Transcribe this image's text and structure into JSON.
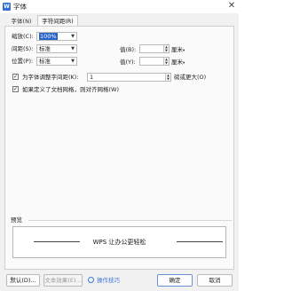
{
  "window": {
    "title": "字体",
    "app_icon_letter": "W",
    "close_glyph": "✕"
  },
  "tabs": [
    {
      "label": "字体(N)",
      "active": false
    },
    {
      "label": "字符间距(R)",
      "active": true
    }
  ],
  "fields": {
    "scale": {
      "label": "缩放(C):",
      "value": "100%"
    },
    "spacing": {
      "label": "间距(S):",
      "value": "标准",
      "value_label": "值(B):",
      "value_text": "",
      "unit": "厘米"
    },
    "position": {
      "label": "位置(P):",
      "value": "标准",
      "value_label": "值(Y):",
      "value_text": "",
      "unit": "厘米"
    }
  },
  "kerning": {
    "label": "为字体调整字间距(K):",
    "checked": true,
    "value": "1",
    "suffix": "磅或更大(O)"
  },
  "snap_grid": {
    "label": "如果定义了文档网格，则对齐网格(W)",
    "checked": true
  },
  "preview": {
    "label": "预览",
    "text": "WPS 让办公更轻松"
  },
  "buttons": {
    "default": "默认(D)...",
    "text_effect": "文本效果(E)...",
    "tips": "操作技巧",
    "ok": "确定",
    "cancel": "取消"
  },
  "colors": {
    "accent": "#2a63c8",
    "link": "#3a78d8"
  }
}
